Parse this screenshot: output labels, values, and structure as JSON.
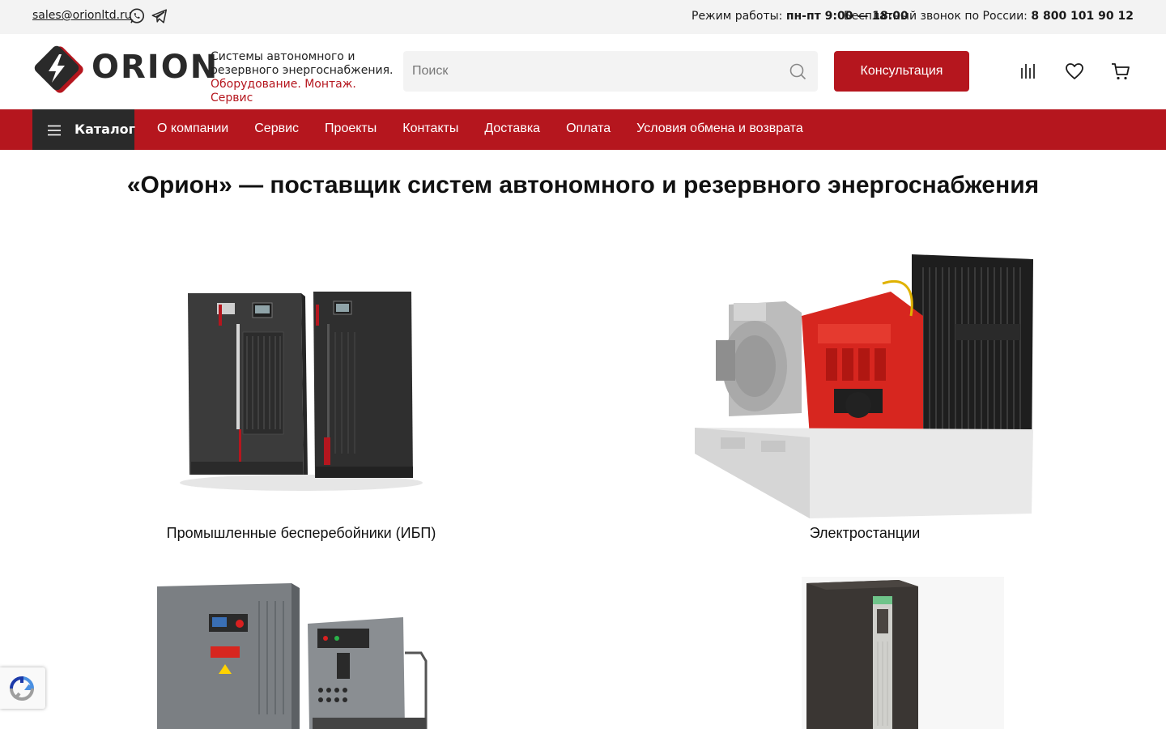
{
  "topbar": {
    "email": "sales@orionltd.ru",
    "hours_label": "Режим работы:",
    "hours_value": "пн-пт 9:00 — 18:00",
    "call_label": "Бесплатный звонок по России:",
    "call_value": "8 800 101 90 12"
  },
  "header": {
    "logo_text": "ORION",
    "tagline_line1": "Системы автономного и",
    "tagline_line2": "резервного энергоснабжения.",
    "tagline_accent": "Оборудование. Монтаж. Сервис",
    "search_placeholder": "Поиск",
    "consult_label": "Консультация"
  },
  "nav": {
    "catalog_label": "Каталог",
    "links": [
      "О компании",
      "Сервис",
      "Проекты",
      "Контакты",
      "Доставка",
      "Оплата",
      "Условия обмена и возврата"
    ]
  },
  "main": {
    "title": "«Орион» — поставщик систем автономного и резервного энергоснабжения",
    "categories": [
      {
        "label": "Промышленные бесперебойники (ИБП)",
        "icon": "ups-cabinets-image"
      },
      {
        "label": "Электростанции",
        "icon": "diesel-generator-image"
      },
      {
        "label": "",
        "icon": "air-compressor-image"
      },
      {
        "label": "",
        "icon": "voltage-stabilizer-image"
      }
    ]
  },
  "colors": {
    "brand_red": "#b5161e",
    "dark": "#2a2a2a",
    "topbar_bg": "#f3f3f3"
  }
}
